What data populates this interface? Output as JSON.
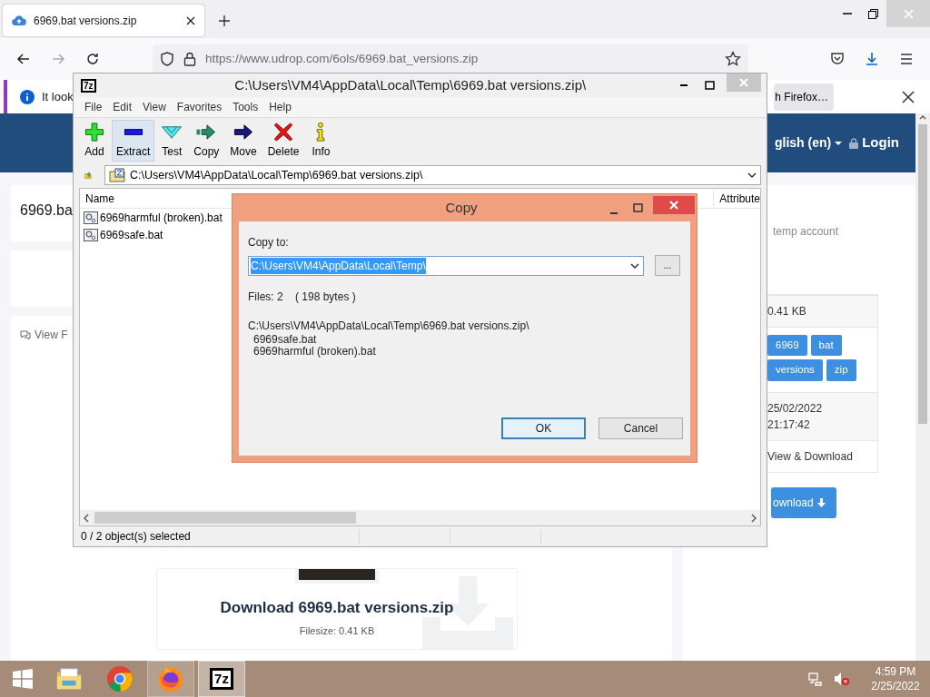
{
  "browser": {
    "tab": {
      "title": "6969.bat versions.zip"
    },
    "url": "https://www.udrop.com/6ols/6969.bat_versions.zip",
    "notification": {
      "text": "It look",
      "button": "h Firefox…"
    }
  },
  "page": {
    "nav": [
      {
        "kind": "language",
        "label": "glish (en)"
      },
      {
        "kind": "login",
        "label": "Login"
      }
    ],
    "title": "6969.ba",
    "view_link": "View F",
    "account_note": "temp account",
    "details": [
      {
        "kind": "text",
        "lines": [
          "0.41 KB"
        ]
      },
      {
        "kind": "tags",
        "tags": [
          "6969",
          "bat",
          "versions",
          "zip"
        ]
      },
      {
        "kind": "text",
        "lines": [
          "25/02/2022",
          "21:17:42"
        ]
      },
      {
        "kind": "text",
        "lines": [
          "View & Download"
        ]
      }
    ],
    "download_button": "ownload",
    "download_card": {
      "title": "Download 6969.bat versions.zip",
      "filesize": "Filesize: 0.41 KB"
    }
  },
  "archive_window": {
    "icon_text": "7z",
    "title": "C:\\Users\\VM4\\AppData\\Local\\Temp\\6969.bat versions.zip\\",
    "menu": [
      "File",
      "Edit",
      "View",
      "Favorites",
      "Tools",
      "Help"
    ],
    "toolbar": [
      {
        "kind": "add",
        "label": "Add",
        "selected": false
      },
      {
        "kind": "extract",
        "label": "Extract",
        "selected": true
      },
      {
        "kind": "test",
        "label": "Test",
        "selected": false
      },
      {
        "kind": "copy",
        "label": "Copy",
        "selected": false
      },
      {
        "kind": "move",
        "label": "Move",
        "selected": false
      },
      {
        "kind": "delete",
        "label": "Delete",
        "selected": false
      },
      {
        "kind": "info",
        "label": "Info",
        "selected": false
      }
    ],
    "path": "C:\\Users\\VM4\\AppData\\Local\\Temp\\6969.bat versions.zip\\",
    "columns": [
      "Name",
      "Attribute"
    ],
    "files": [
      {
        "name": "6969harmful (broken).bat"
      },
      {
        "name": "6969safe.bat"
      }
    ],
    "status": "0 / 2 object(s) selected"
  },
  "copy_dialog": {
    "title": "Copy",
    "label": "Copy to:",
    "destination": {
      "value": "C:\\Users\\VM4\\AppData\\Local\\Temp\\",
      "highlighted": true
    },
    "browse": "...",
    "summary": "Files: 2    ( 198 bytes )",
    "source": "C:\\Users\\VM4\\AppData\\Local\\Temp\\6969.bat versions.zip\\",
    "items": [
      "6969safe.bat",
      "6969harmful (broken).bat"
    ],
    "buttons": [
      {
        "label": "OK",
        "default": true
      },
      {
        "label": "Cancel",
        "default": false
      }
    ]
  },
  "taskbar": {
    "apps": [
      {
        "kind": "explorer",
        "running": false,
        "selected": false
      },
      {
        "kind": "chrome",
        "running": false,
        "selected": false
      },
      {
        "kind": "firefox",
        "running": true,
        "selected": false
      },
      {
        "kind": "sevenzip",
        "label": "7z",
        "running": true,
        "selected": true
      }
    ],
    "clock": {
      "time": "4:59 PM",
      "date": "2/25/2022"
    }
  }
}
